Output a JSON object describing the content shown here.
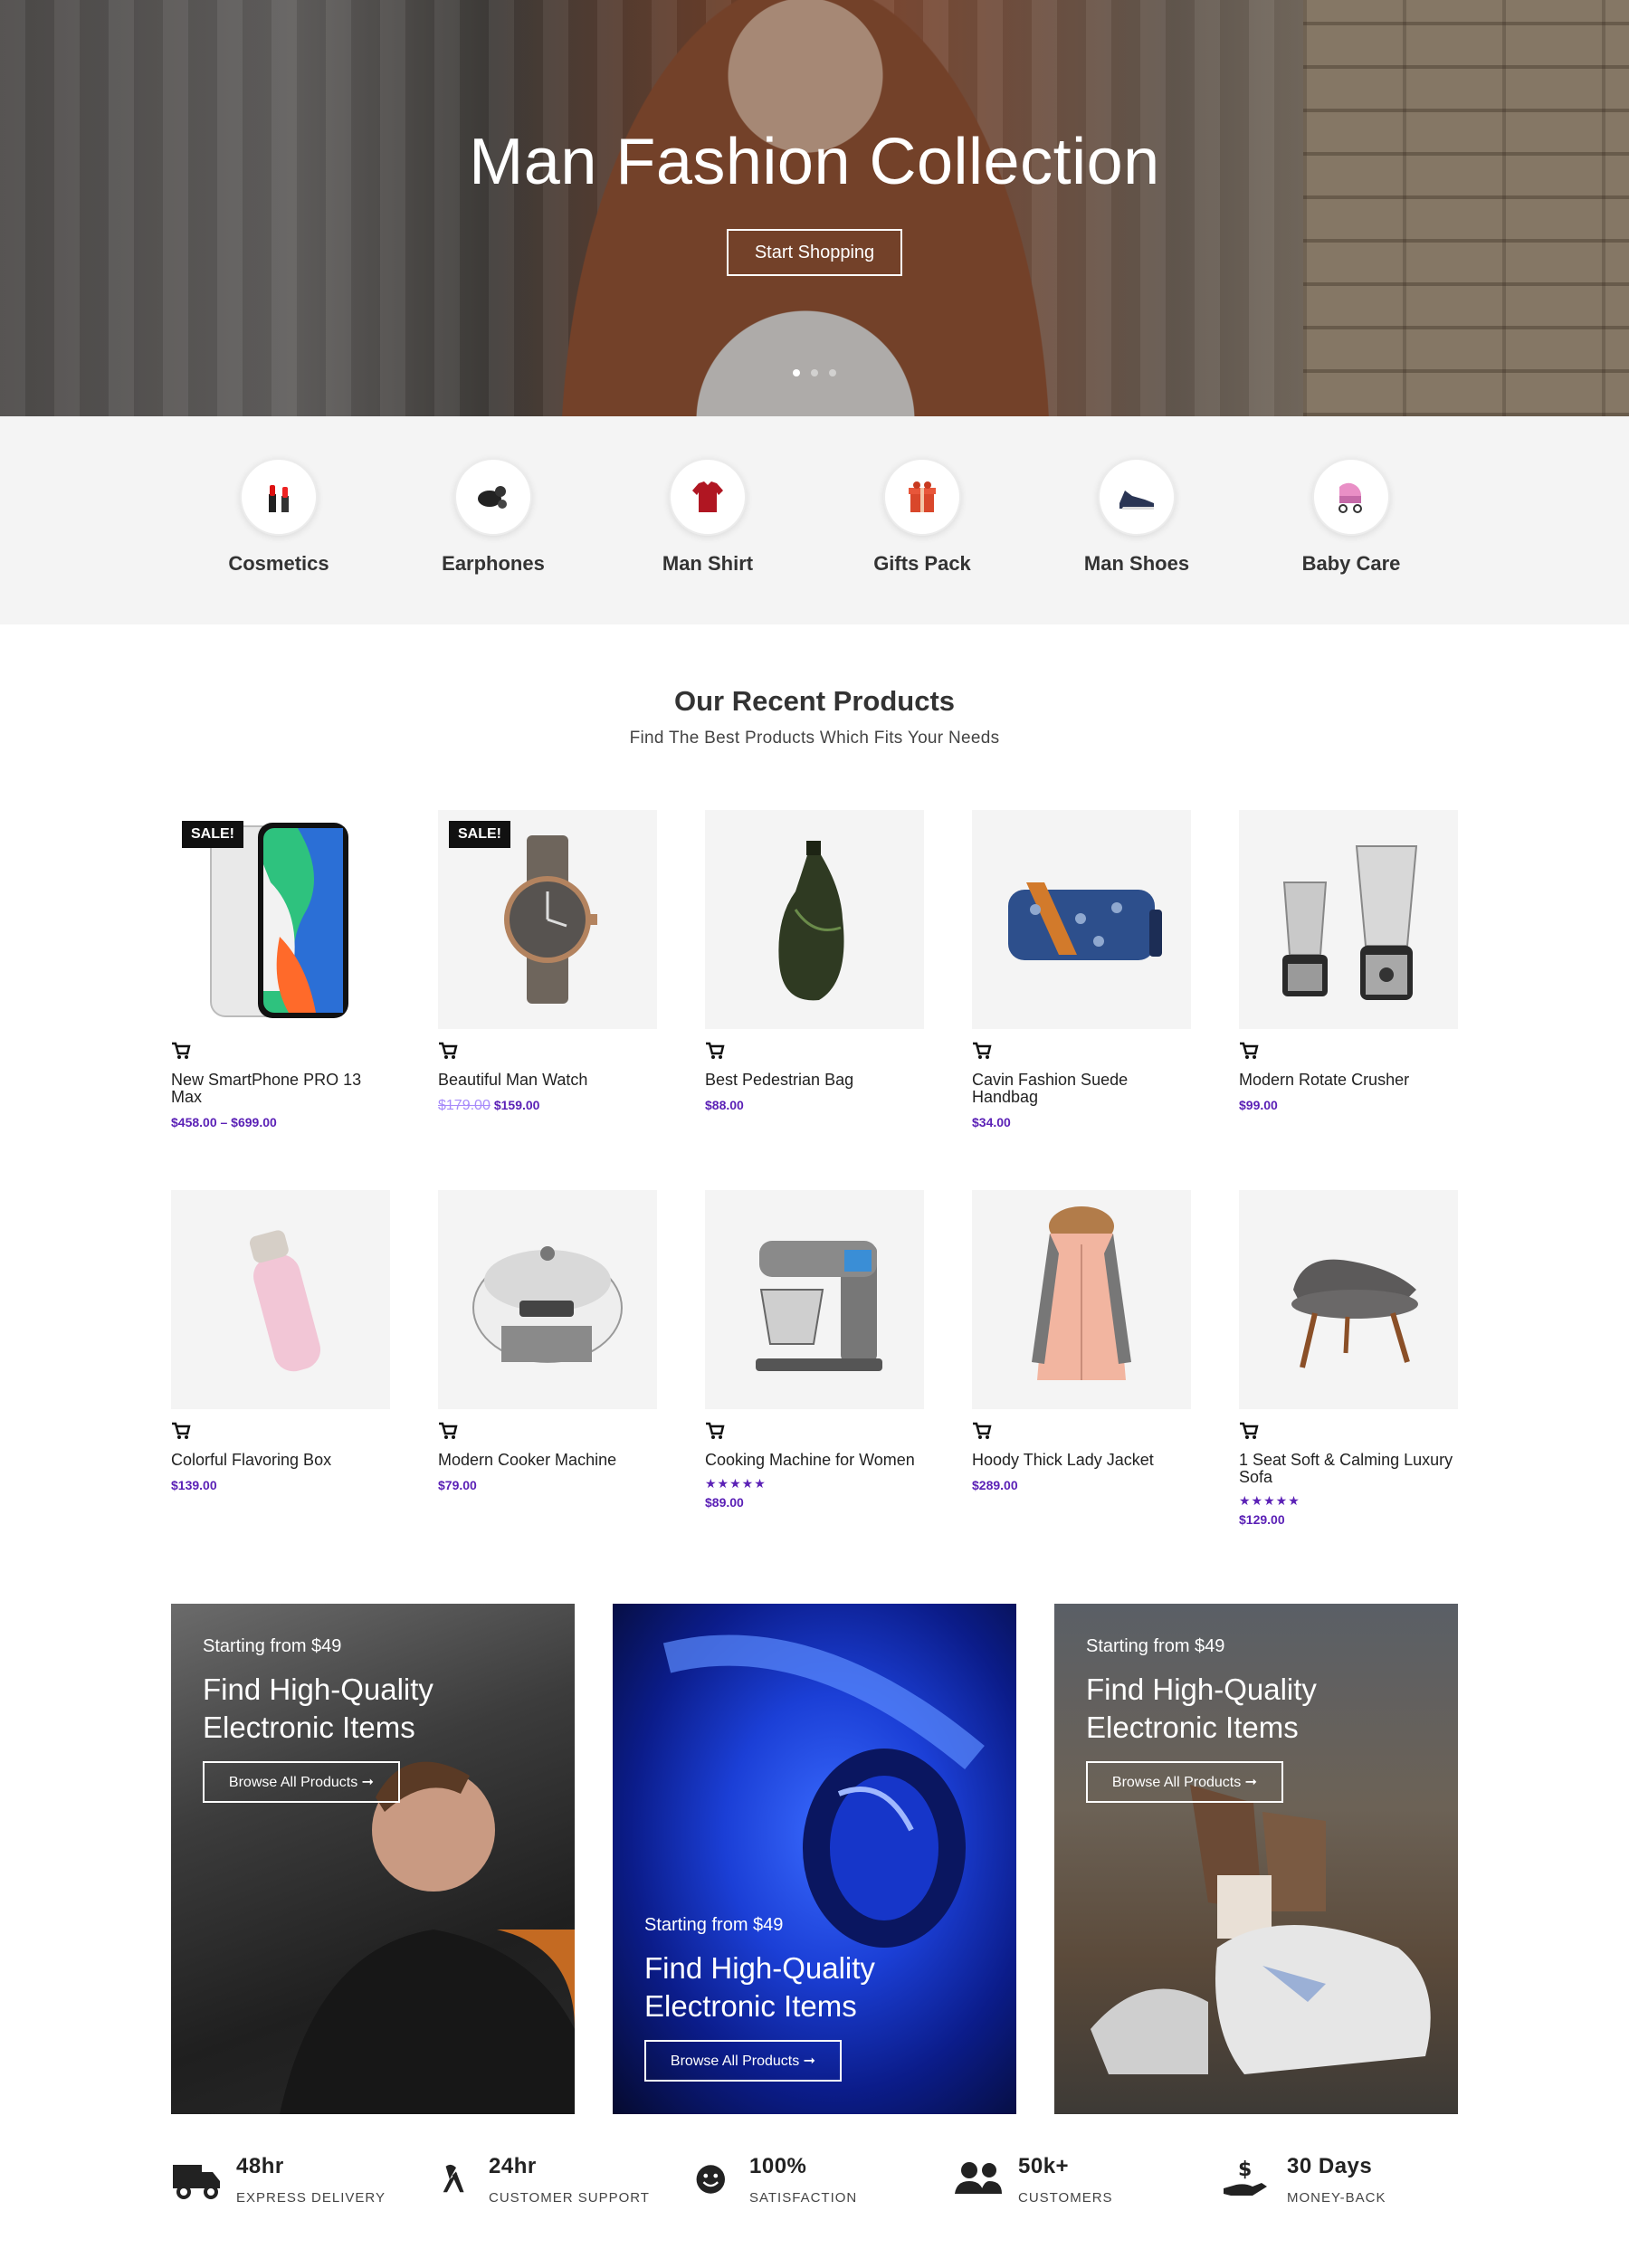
{
  "hero": {
    "title": "Man Fashion Collection",
    "button": "Start Shopping",
    "slides": 3,
    "active_slide": 1
  },
  "categories": [
    {
      "label": "Cosmetics",
      "icon": "lipstick-icon"
    },
    {
      "label": "Earphones",
      "icon": "earphones-icon"
    },
    {
      "label": "Man Shirt",
      "icon": "shirt-icon"
    },
    {
      "label": "Gifts Pack",
      "icon": "gift-icon"
    },
    {
      "label": "Man Shoes",
      "icon": "shoe-icon"
    },
    {
      "label": "Baby Care",
      "icon": "stroller-icon"
    }
  ],
  "section": {
    "title": "Our Recent Products",
    "subtitle": "Find The Best Products Which Fits Your Needs"
  },
  "products": [
    {
      "name": "New SmartPhone PRO 13 Max",
      "price": "$458.00 – $699.00",
      "sale": "SALE!",
      "old_price": "",
      "rating": 0
    },
    {
      "name": "Beautiful Man Watch",
      "price": "$159.00",
      "sale": "SALE!",
      "old_price": "$179.00",
      "rating": 0
    },
    {
      "name": "Best Pedestrian Bag",
      "price": "$88.00",
      "sale": "",
      "old_price": "",
      "rating": 0
    },
    {
      "name": "Cavin Fashion Suede Handbag",
      "price": "$34.00",
      "sale": "",
      "old_price": "",
      "rating": 0
    },
    {
      "name": "Modern Rotate Crusher",
      "price": "$99.00",
      "sale": "",
      "old_price": "",
      "rating": 0
    },
    {
      "name": "Colorful Flavoring Box",
      "price": "$139.00",
      "sale": "",
      "old_price": "",
      "rating": 0
    },
    {
      "name": "Modern Cooker Machine",
      "price": "$79.00",
      "sale": "",
      "old_price": "",
      "rating": 0
    },
    {
      "name": "Cooking Machine for Women",
      "price": "$89.00",
      "sale": "",
      "old_price": "",
      "rating": 5
    },
    {
      "name": "Hoody Thick Lady Jacket",
      "price": "$289.00",
      "sale": "",
      "old_price": "",
      "rating": 0
    },
    {
      "name": "1 Seat Soft & Calming Luxury Sofa",
      "price": "$129.00",
      "sale": "",
      "old_price": "",
      "rating": 5
    }
  ],
  "banners": [
    {
      "starting": "Starting from $49",
      "title": "Find High-Quality Electronic Items",
      "button": "Browse All Products ➞"
    },
    {
      "starting": "Starting from $49",
      "title": "Find High-Quality Electronic Items",
      "button": "Browse All Products ➞"
    },
    {
      "starting": "Starting from $49",
      "title": "Find High-Quality Electronic Items",
      "button": "Browse All Products ➞"
    }
  ],
  "features": [
    {
      "value": "48hr",
      "label": "EXPRESS DELIVERY",
      "icon": "truck-icon"
    },
    {
      "value": "24hr",
      "label": "CUSTOMER SUPPORT",
      "icon": "ribbon-icon"
    },
    {
      "value": "100%",
      "label": "SATISFACTION",
      "icon": "smile-icon"
    },
    {
      "value": "50k+",
      "label": "CUSTOMERS",
      "icon": "users-icon"
    },
    {
      "value": "30 Days",
      "label": "MONEY-BACK",
      "icon": "money-hand-icon"
    }
  ],
  "colors": {
    "accent": "#5b21b6",
    "category_bg": "#f4f4f4",
    "sale_badge": "#111111"
  }
}
